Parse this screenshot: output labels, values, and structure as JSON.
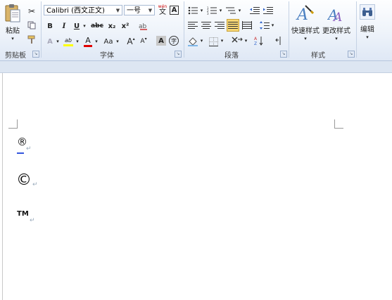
{
  "ribbon": {
    "clipboard": {
      "paste_label": "粘贴",
      "group_label": "剪贴板"
    },
    "font": {
      "font_name": "Calibri (西文正文)",
      "font_size": "一号",
      "group_label": "字体",
      "bold": "B",
      "italic": "I",
      "underline": "U",
      "strike": "abc",
      "subscript": "x₂",
      "superscript": "x²",
      "font_color": "A",
      "change_case": "Aa",
      "grow": "A",
      "shrink": "A",
      "wen": "wén",
      "char_border": "A",
      "enclose": "字",
      "highlight": "ab",
      "grey_a": "A"
    },
    "paragraph": {
      "group_label": "段落"
    },
    "styles": {
      "quick_styles_label": "快速样式",
      "change_styles_label": "更改样式",
      "group_label": "样式"
    },
    "editing": {
      "label": "编辑"
    }
  },
  "document": {
    "line1_symbol": "®",
    "line2_symbol": "©",
    "line3_symbol": "TM",
    "para_mark": "↵"
  },
  "colors": {
    "highlight_yellow": "#ffff00",
    "font_red": "#e00000",
    "selected_blue": "#f7d775"
  }
}
